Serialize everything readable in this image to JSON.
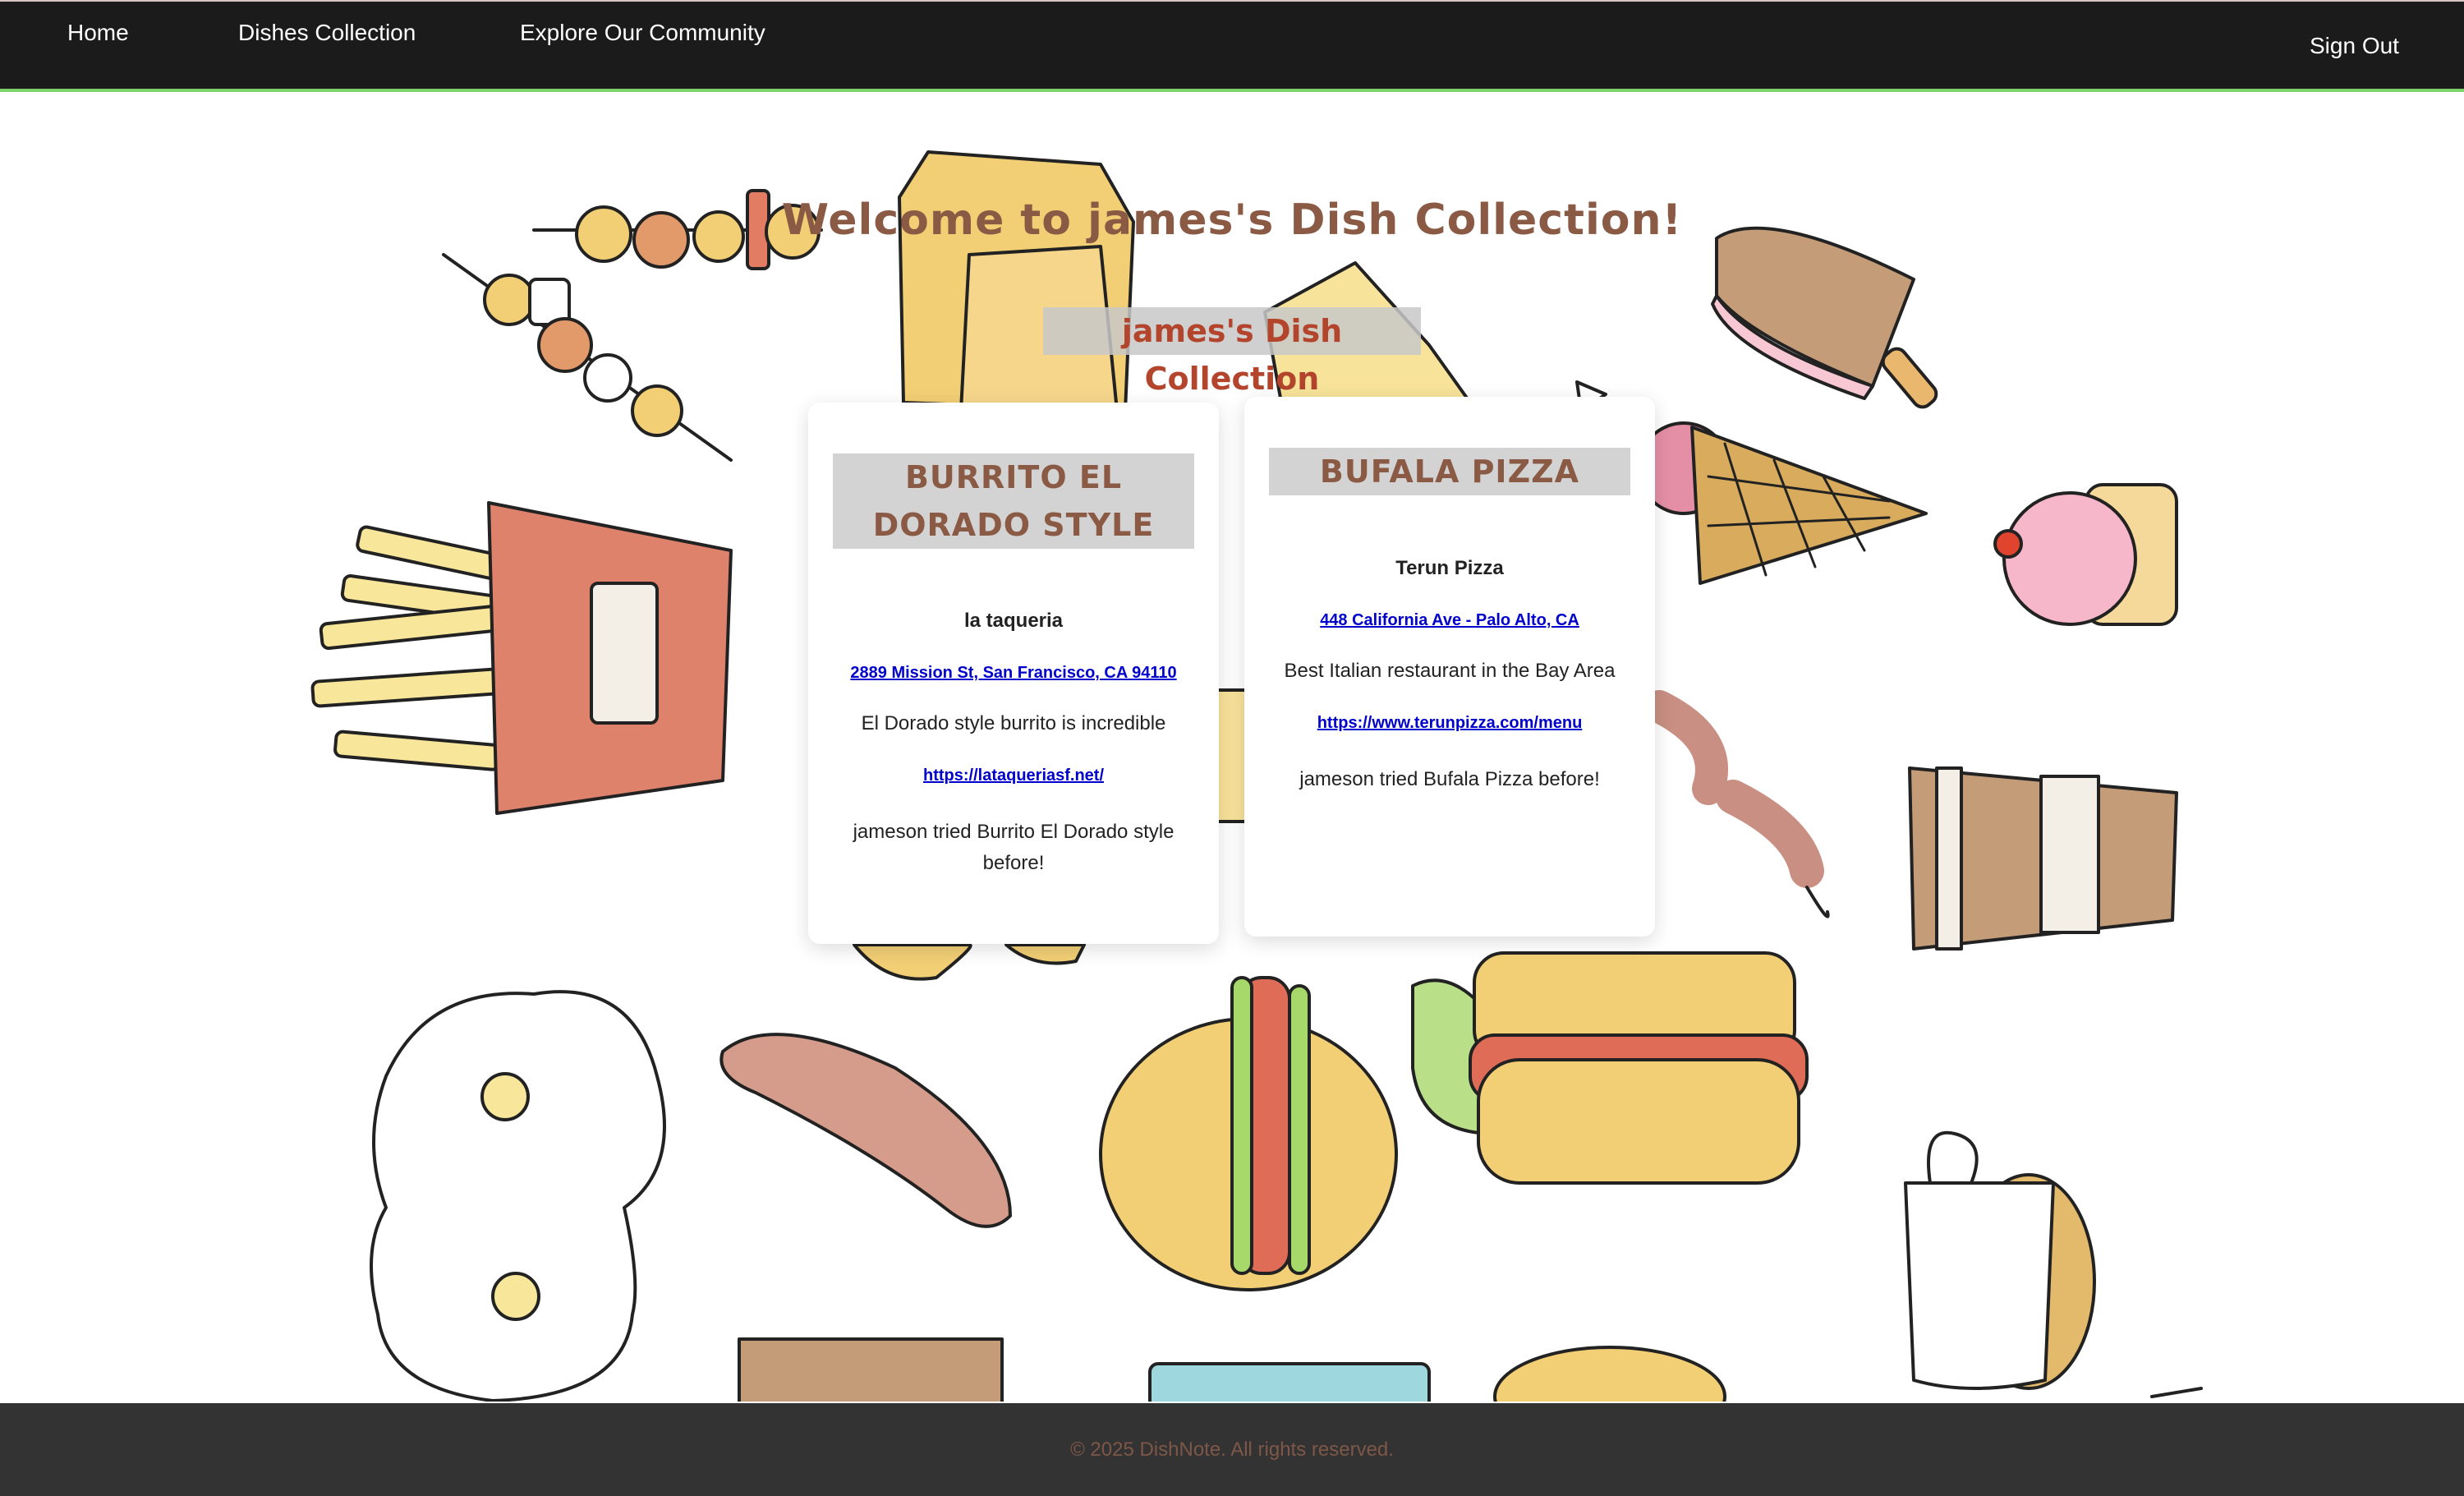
{
  "nav": {
    "home": "Home",
    "dishes": "Dishes Collection",
    "community": "Explore Our Community",
    "signout": "Sign Out"
  },
  "welcome": "Welcome to james's Dish Collection!",
  "collection_title": "james's Dish Collection",
  "cards": [
    {
      "title": "BURRITO EL DORADO STYLE",
      "restaurant": "la taqueria",
      "address": "2889 Mission St, San Francisco, CA 94110",
      "description": "El Dorado style burrito is incredible",
      "url": "https://lataqueriasf.net/",
      "tried": "jameson tried Burrito El Dorado style before!"
    },
    {
      "title": "BUFALA PIZZA",
      "restaurant": "Terun Pizza",
      "address": "448 California Ave - Palo Alto, CA",
      "description": "Best Italian restaurant in the Bay Area",
      "url": "https://www.terunpizza.com/menu",
      "tried": "jameson tried Bufala Pizza before!"
    }
  ],
  "footer": "© 2025 DishNote. All rights reserved.",
  "colors": {
    "nav_bg": "#1b1b1b",
    "accent_brown": "#8a5a45",
    "accent_red": "#b2452c",
    "link_blue": "#0000cc",
    "footer_bg": "#333333"
  }
}
